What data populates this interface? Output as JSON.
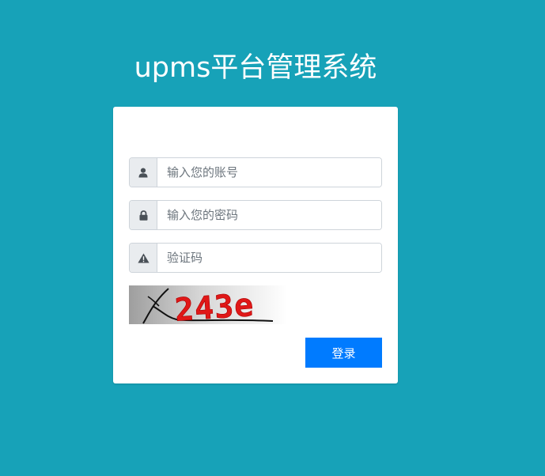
{
  "page": {
    "title": "upms平台管理系统",
    "background_color": "#17a2b8"
  },
  "login_form": {
    "username": {
      "placeholder": "输入您的账号",
      "value": "",
      "icon": "user-icon"
    },
    "password": {
      "placeholder": "输入您的密码",
      "value": "",
      "icon": "lock-icon"
    },
    "captcha_input": {
      "placeholder": "验证码",
      "value": "",
      "icon": "warning-icon"
    },
    "captcha_image": {
      "text": "243e"
    },
    "submit_label": "登录",
    "submit_color": "#007bff"
  }
}
